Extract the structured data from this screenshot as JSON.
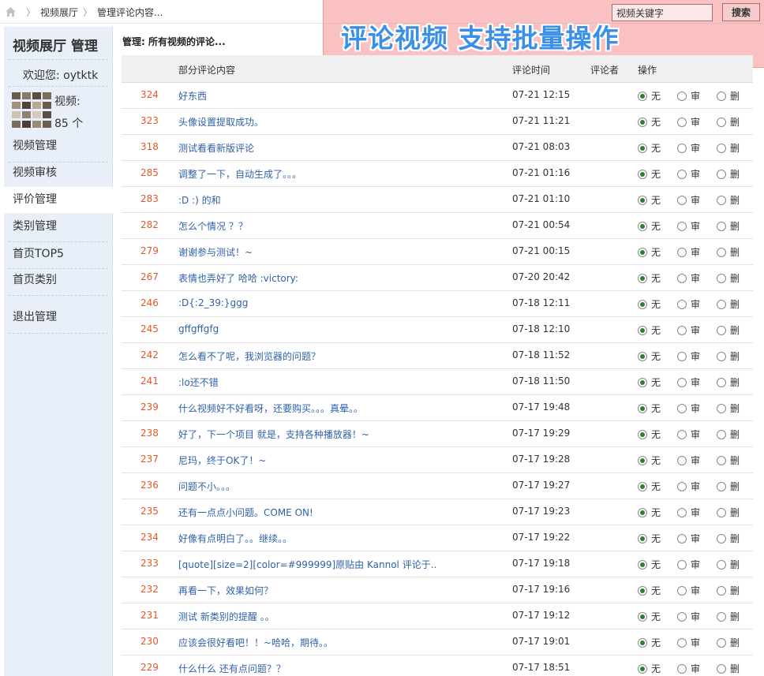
{
  "breadcrumb": {
    "items": [
      "视频展厅",
      "管理评论内容..."
    ]
  },
  "banner": {
    "text": "评论视频  支持批量操作"
  },
  "search": {
    "placeholder": "视频关键字",
    "button_label": "搜索"
  },
  "sidebar": {
    "title": "视频展厅 管理",
    "welcome": "欢迎您: oytktk",
    "stats_label": "视频:",
    "stats_count": "85 个",
    "items": [
      {
        "label": "视频管理"
      },
      {
        "label": "视频审核"
      },
      {
        "label": "评价管理"
      },
      {
        "label": "类别管理"
      },
      {
        "label": "首页TOP5"
      },
      {
        "label": "首页类别"
      },
      {
        "label": "退出管理"
      }
    ]
  },
  "main": {
    "title": "管理: 所有视频的评论...",
    "headers": {
      "content": "部分评论内容",
      "time": "评论时间",
      "author": "评论者",
      "action": "操作"
    },
    "option_labels": [
      "无",
      "审",
      "删"
    ],
    "rows": [
      {
        "id": "324",
        "text": "好东西",
        "time": "07-21 12:15"
      },
      {
        "id": "323",
        "text": "头像设置提取成功。",
        "time": "07-21 11:21"
      },
      {
        "id": "318",
        "text": "测试看看新版评论",
        "time": "07-21 08:03"
      },
      {
        "id": "285",
        "text": "调整了一下，自动生成了。。。",
        "time": "07-21 01:16"
      },
      {
        "id": "283",
        "text": ":D :) 的和",
        "time": "07-21 01:10"
      },
      {
        "id": "282",
        "text": "怎么个情况 ？？",
        "time": "07-21 00:54"
      },
      {
        "id": "279",
        "text": "谢谢参与测试！~",
        "time": "07-21 00:15"
      },
      {
        "id": "267",
        "text": "表情也弄好了 哈哈 :victory:",
        "time": "07-20 20:42"
      },
      {
        "id": "246",
        "text": ":D{:2_39:}ggg",
        "time": "07-18 12:11"
      },
      {
        "id": "245",
        "text": "gffgffgfg",
        "time": "07-18 12:10"
      },
      {
        "id": "242",
        "text": "怎么看不了呢，我浏览器的问题？",
        "time": "07-18 11:52"
      },
      {
        "id": "241",
        "text": ":lo还不错",
        "time": "07-18 11:50"
      },
      {
        "id": "239",
        "text": "什么视频好不好看呀，还要购买。。。真晕。。",
        "time": "07-17 19:48"
      },
      {
        "id": "238",
        "text": "好了，下一个项目 就是，支持各种播放器！~",
        "time": "07-17 19:29"
      },
      {
        "id": "237",
        "text": "尼玛，终于OK了！~",
        "time": "07-17 19:28"
      },
      {
        "id": "236",
        "text": "问题不小。。。",
        "time": "07-17 19:27"
      },
      {
        "id": "235",
        "text": "还有一点点小问题。COME ON!",
        "time": "07-17 19:23"
      },
      {
        "id": "234",
        "text": "好像有点明白了。。继续。。",
        "time": "07-17 19:22"
      },
      {
        "id": "233",
        "text": "[quote][size=2][color=#999999]原贴由 Kannol 评论于..",
        "time": "07-17 19:18"
      },
      {
        "id": "232",
        "text": "再看一下，效果如何？",
        "time": "07-17 19:16"
      },
      {
        "id": "231",
        "text": "测试 新类别的提醒 。。",
        "time": "07-17 19:12"
      },
      {
        "id": "230",
        "text": "应该会很好看吧！！~哈哈，期待。。",
        "time": "07-17 19:01"
      },
      {
        "id": "229",
        "text": "什么什么 还有点问题？？",
        "time": "07-17 18:51"
      }
    ]
  }
}
